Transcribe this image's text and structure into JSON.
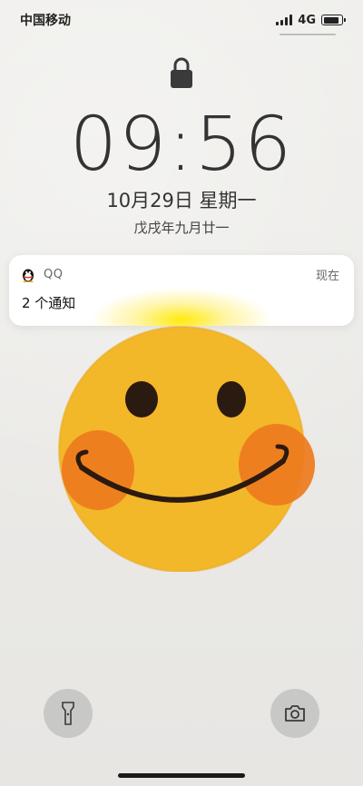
{
  "status_bar": {
    "carrier": "中国移动",
    "network": "4G",
    "battery_level": 0.8
  },
  "lock_screen": {
    "time": "09:56",
    "date": "10月29日 星期一",
    "lunar_date": "戊戌年九月廿一"
  },
  "notification": {
    "app_name": "QQ",
    "time": "现在",
    "message": "2 个通知",
    "app_icon": "qq-penguin-icon"
  },
  "controls": {
    "flashlight_icon": "flashlight-icon",
    "camera_icon": "camera-icon"
  },
  "colors": {
    "smiley_fill": "#f3b72a",
    "cheek": "#ee7a1d",
    "glow": "#ffe900"
  }
}
